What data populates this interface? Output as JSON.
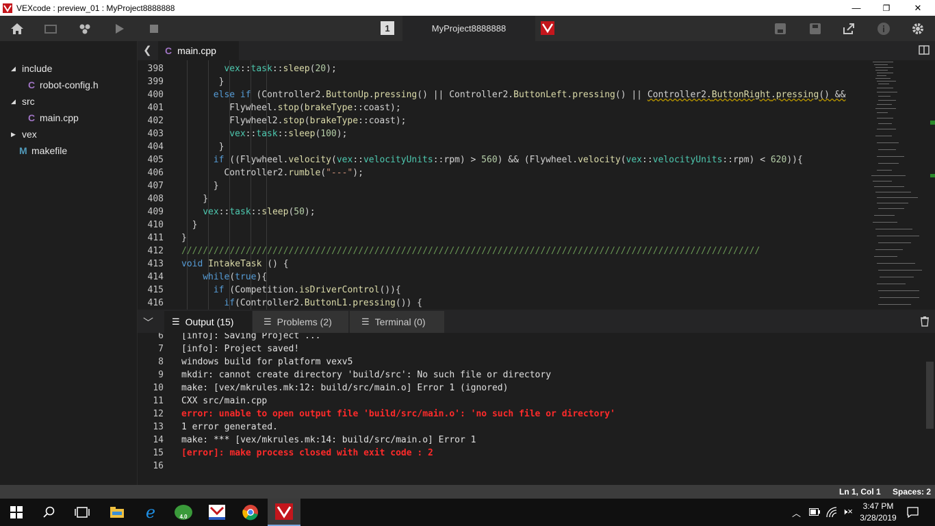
{
  "window": {
    "title": "VEXcode : preview_01 : MyProject8888888",
    "min": "—",
    "max": "❐",
    "close": "✕"
  },
  "toolbar": {
    "project_name": "MyProject8888888",
    "slot": "1"
  },
  "sidebar": {
    "items": [
      {
        "label": "include",
        "chev": "◢"
      },
      {
        "label": "robot-config.h",
        "icon": "C"
      },
      {
        "label": "src",
        "chev": "◢"
      },
      {
        "label": "main.cpp",
        "icon": "C"
      },
      {
        "label": "vex",
        "chev": "▶"
      },
      {
        "label": "makefile",
        "icon": "M"
      }
    ]
  },
  "editor": {
    "tab_label": "main.cpp",
    "back": "❮",
    "lines": [
      {
        "n": "398",
        "indent": 8,
        "html": "<span class='ty'>vex</span>::<span class='ty'>task</span>::<span class='fn'>sleep</span>(<span class='num'>20</span>);"
      },
      {
        "n": "399",
        "indent": 7,
        "html": "}"
      },
      {
        "n": "400",
        "indent": 6,
        "html": "<span class='kw'>else if</span> (Controller2.<span class='fn'>ButtonUp</span>.<span class='fn'>pressing</span>() || Controller2.<span class='fn'>ButtonLeft</span>.<span class='fn'>pressing</span>() || <span style='text-decoration:underline wavy #b89500'>Controller2.<span class='fn'>ButtonRight</span>.<span class='fn'>pressing</span>() &amp;&amp;</span>"
      },
      {
        "n": "401",
        "indent": 9,
        "html": "Flywheel.<span class='fn'>stop</span>(<span class='fn'>brakeType</span>::coast);"
      },
      {
        "n": "402",
        "indent": 9,
        "html": "Flywheel2.<span class='fn'>stop</span>(<span class='fn'>brakeType</span>::coast);"
      },
      {
        "n": "403",
        "indent": 9,
        "html": "<span class='ty'>vex</span>::<span class='ty'>task</span>::<span class='fn'>sleep</span>(<span class='num'>100</span>);"
      },
      {
        "n": "404",
        "indent": 7,
        "html": "}"
      },
      {
        "n": "405",
        "indent": 6,
        "html": "<span class='kw'>if</span> ((Flywheel.<span class='fn'>velocity</span>(<span class='ty'>vex</span>::<span class='ty'>velocityUnits</span>::rpm) &gt; <span class='num'>560</span>) &amp;&amp; (Flywheel.<span class='fn'>velocity</span>(<span class='ty'>vex</span>::<span class='ty'>velocityUnits</span>::rpm) &lt; <span class='num'>620</span>)){"
      },
      {
        "n": "406",
        "indent": 8,
        "html": "Controller2.<span class='fn'>rumble</span>(<span class='str'>\"---\"</span>);"
      },
      {
        "n": "407",
        "indent": 6,
        "html": "}"
      },
      {
        "n": "408",
        "indent": 4,
        "html": "}"
      },
      {
        "n": "409",
        "indent": 4,
        "html": "<span class='ty'>vex</span>::<span class='ty'>task</span>::<span class='fn'>sleep</span>(<span class='num'>50</span>);"
      },
      {
        "n": "410",
        "indent": 2,
        "html": "}"
      },
      {
        "n": "411",
        "indent": 0,
        "html": "}"
      },
      {
        "n": "412",
        "indent": 0,
        "html": "<span class='cm'>////////////////////////////////////////////////////////////////////////////////////////////////////////////</span>"
      },
      {
        "n": "413",
        "indent": 0,
        "html": "<span class='kw'>void</span> <span class='fn'>IntakeTask</span> () {"
      },
      {
        "n": "414",
        "indent": 4,
        "html": "<span class='kw'>while</span>(<span class='kw'>true</span>){"
      },
      {
        "n": "415",
        "indent": 6,
        "html": "<span class='kw'>if</span> (Competition.<span class='fn'>isDriverControl</span>()){"
      },
      {
        "n": "416",
        "indent": 8,
        "html": "<span class='kw'>if</span>(Controller2.<span class='fn'>ButtonL1</span>.<span class='fn'>pressing</span>()) {"
      }
    ]
  },
  "panel": {
    "tabs": [
      {
        "label": "Output (15)"
      },
      {
        "label": "Problems (2)"
      },
      {
        "label": "Terminal (0)"
      }
    ],
    "output": [
      {
        "n": "6",
        "text": "[info]: Saving Project ...",
        "err": false
      },
      {
        "n": "7",
        "text": "[info]: Project saved!",
        "err": false
      },
      {
        "n": "8",
        "text": "windows build for platform vexv5",
        "err": false
      },
      {
        "n": "9",
        "text": "mkdir: cannot create directory 'build/src': No such file or directory",
        "err": false
      },
      {
        "n": "10",
        "text": "make: [vex/mkrules.mk:12: build/src/main.o] Error 1 (ignored)",
        "err": false
      },
      {
        "n": "11",
        "text": "CXX src/main.cpp",
        "err": false
      },
      {
        "n": "12",
        "text": "error: unable to open output file 'build/src/main.o': 'no such file or directory'",
        "err": true
      },
      {
        "n": "13",
        "text": "1 error generated.",
        "err": false
      },
      {
        "n": "14",
        "text": "make: *** [vex/mkrules.mk:14: build/src/main.o] Error 1",
        "err": false
      },
      {
        "n": "15",
        "text": "[error]: make process closed with exit code : 2",
        "err": true
      },
      {
        "n": "16",
        "text": "",
        "err": false
      }
    ]
  },
  "status": {
    "position": "Ln 1, Col 1",
    "spaces": "Spaces: 2"
  },
  "taskbar": {
    "time": "3:47 PM",
    "date": "3/28/2019",
    "badge": "4.0"
  },
  "colors": {
    "accent": "#e11b22",
    "error": "#ff2a2a"
  }
}
